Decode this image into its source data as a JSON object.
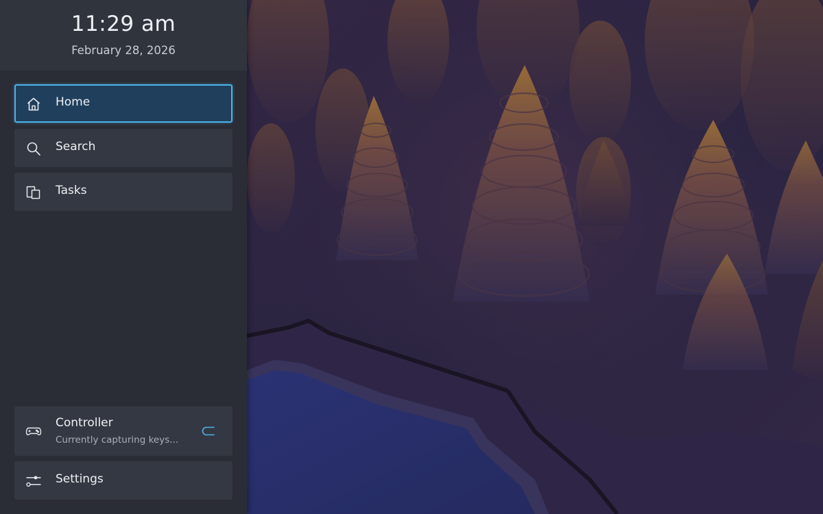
{
  "clock": {
    "time": "11:29 am",
    "date": "February 28, 2026"
  },
  "nav": {
    "items": [
      {
        "label": "Home",
        "icon": "home-icon",
        "active": true
      },
      {
        "label": "Search",
        "icon": "search-icon",
        "active": false
      },
      {
        "label": "Tasks",
        "icon": "tasks-icon",
        "active": false
      }
    ]
  },
  "controller": {
    "title": "Controller",
    "status": "Currently capturing keys...",
    "icon": "gamepad-icon",
    "toggle_on": false
  },
  "settings": {
    "label": "Settings",
    "icon": "sliders-icon"
  },
  "colors": {
    "accent": "#4fb2e8",
    "sidebar_bg": "#2a2d36",
    "item_bg": "#343842",
    "active_bg": "#1f3f5c"
  }
}
